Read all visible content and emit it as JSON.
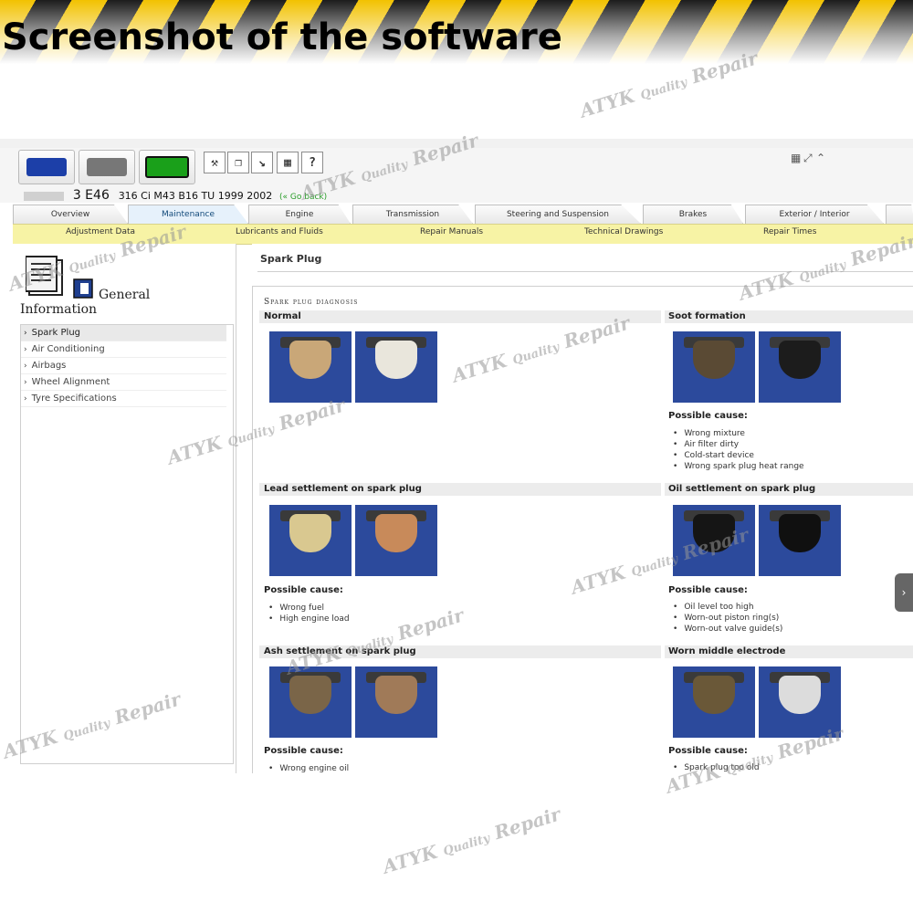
{
  "banner": {
    "title": "Screenshot of the software"
  },
  "header": {
    "mode_buttons": [
      {
        "name": "car",
        "color": "#1c3fa8"
      },
      {
        "name": "truck",
        "color": "#777777"
      },
      {
        "name": "battery",
        "color": "#1aa01a"
      }
    ],
    "tool_icons": [
      "tools-icon",
      "document-icon",
      "resize-icon",
      "calculator-icon",
      "help-icon"
    ],
    "tool_glyphs": [
      "⚒",
      "❐",
      "↘",
      "▦",
      "?"
    ],
    "vehicle": {
      "model": "3 E46",
      "details": "316 Ci M43 B16 TU 1999 2002",
      "back_label": "(« Go back)"
    }
  },
  "tabs": [
    "Overview",
    "Maintenance",
    "Engine",
    "Transmission",
    "Steering and Suspension",
    "Brakes",
    "Exterior / Interior"
  ],
  "active_tab": "Maintenance",
  "subnav": [
    "Adjustment Data",
    "Lubricants and Fluids",
    "Repair Manuals",
    "Technical Drawings",
    "Repair Times"
  ],
  "sidebar": {
    "heading_1": "General",
    "heading_2": "Information",
    "items": [
      "Spark Plug",
      "Air Conditioning",
      "Airbags",
      "Wheel Alignment",
      "Tyre Specifications"
    ],
    "selected": "Spark Plug"
  },
  "content": {
    "page_title": "Spark Plug",
    "panel_heading": "Spark plug diagnosis",
    "cause_heading": "Possible cause:",
    "sections": {
      "normal": {
        "title": "Normal"
      },
      "soot": {
        "title": "Soot formation",
        "causes": [
          "Wrong mixture",
          "Air filter dirty",
          "Cold-start device",
          "Wrong spark plug heat range"
        ]
      },
      "lead": {
        "title": "Lead settlement on spark plug",
        "causes": [
          "Wrong fuel",
          "High engine load"
        ]
      },
      "oil": {
        "title": "Oil settlement on spark plug",
        "causes": [
          "Oil level too high",
          "Worn-out piston ring(s)",
          "Worn-out valve guide(s)"
        ]
      },
      "ash": {
        "title": "Ash settlement on spark plug",
        "causes": [
          "Wrong engine oil"
        ]
      },
      "electrode": {
        "title": "Worn middle electrode",
        "causes": [
          "Spark plug too old"
        ]
      }
    }
  },
  "watermark": {
    "text_a": "ATYK",
    "text_b": "Quality",
    "text_c": "Repair"
  },
  "colors": {
    "banner_yellow": "#f2c200",
    "subnav_yellow": "#f7f3a5",
    "plug_blue": "#2c4a9c",
    "back_green": "#2a9d2a"
  }
}
